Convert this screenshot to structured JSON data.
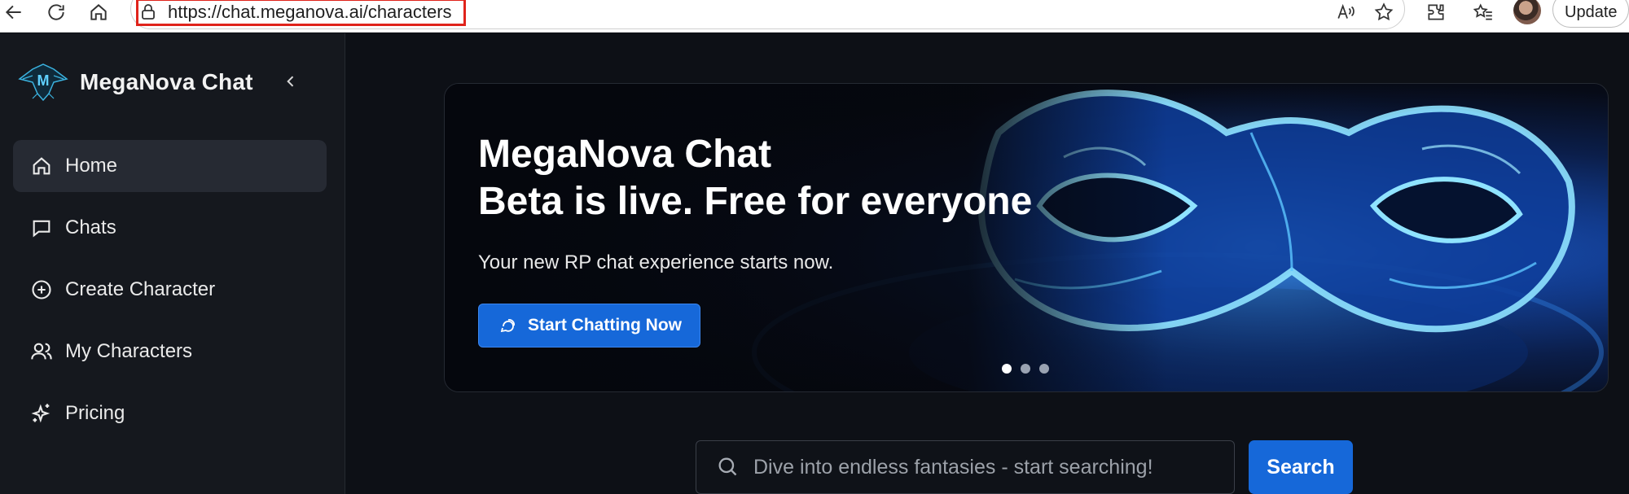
{
  "browser": {
    "url": "https://chat.meganova.ai/characters",
    "update_label": "Update",
    "icons": [
      "back-icon",
      "refresh-icon",
      "home-icon",
      "lock-icon",
      "read-aloud-icon",
      "favorite-star-icon",
      "extensions-icon",
      "favorites-icon",
      "profile-avatar"
    ]
  },
  "sidebar": {
    "brand": "MegaNova Chat",
    "items": [
      {
        "label": "Home",
        "icon": "home-icon",
        "active": true
      },
      {
        "label": "Chats",
        "icon": "chat-bubble-icon"
      },
      {
        "label": "Create Character",
        "icon": "plus-circle-icon"
      },
      {
        "label": "My Characters",
        "icon": "users-icon"
      },
      {
        "label": "Pricing",
        "icon": "sparkles-icon"
      }
    ]
  },
  "banner": {
    "title_line1": "MegaNova Chat",
    "title_line2": "Beta is live. Free for everyone",
    "subtitle": "Your new RP chat experience starts now.",
    "cta_label": "Start Chatting Now",
    "slides": 3,
    "active_slide": 1
  },
  "search": {
    "placeholder": "Dive into endless fantasies - start searching!",
    "button_label": "Search"
  },
  "colors": {
    "accent": "#1668d9",
    "sidebar_bg": "#15181e",
    "main_bg": "#0d1016",
    "active_nav_bg": "#262a33"
  }
}
